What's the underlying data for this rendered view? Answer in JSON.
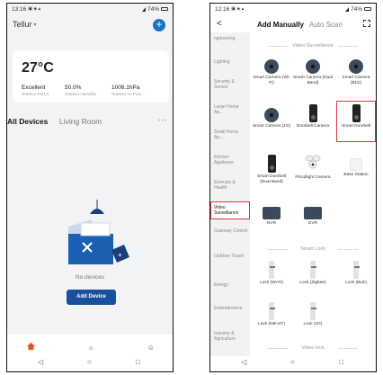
{
  "colors": {
    "accent": "#1a73c8",
    "button": "#1a4f9c",
    "highlight": "#d9363e",
    "home_active": "#e2541a"
  },
  "left": {
    "status": {
      "time": "13:16",
      "battery": "74%"
    },
    "home_name": "Tellur",
    "weather": {
      "temperature": "27°C",
      "stats": [
        {
          "value": "Excellent",
          "label": "Outdoor PM2.5"
        },
        {
          "value": "50.0%",
          "label": "Outdoor Humidity"
        },
        {
          "value": "1006.1hPa",
          "label": "Outdoor Air Pres..."
        }
      ]
    },
    "tabs": [
      "All Devices",
      "Living Room"
    ],
    "more": "···",
    "empty_text": "No devices",
    "add_device_label": "Add Device",
    "nav": [
      {
        "label": "Home",
        "icon": "home-icon"
      },
      {
        "label": "Smart",
        "icon": "sun-icon"
      },
      {
        "label": "Me",
        "icon": "user-icon"
      }
    ]
  },
  "right": {
    "status": {
      "time": "12:16",
      "battery": "74%"
    },
    "header": {
      "back": "<",
      "tab_manual": "Add Manually",
      "tab_auto": "Auto Scan"
    },
    "sidebar": [
      "ngineering",
      "Lighting",
      "Security & Sensor",
      "Large Home Ap...",
      "Small Home Ap...",
      "Kitchen Appliance",
      "Exercise & Health",
      "Video Surveillance",
      "Gateway Control",
      "Outdoor Travel",
      "Energy",
      "Entertainment",
      "Industry & Agriculture"
    ],
    "sections": {
      "video": "Video Surveillance",
      "lock": "Smart Lock",
      "video_lock": "Video lock"
    },
    "video_devices": [
      "Smart Camera (Wi-Fi)",
      "Smart Camera (Dual Band)",
      "Smart Camera (BLE)",
      "Smart Camera (4G)",
      "Doorbell Camera",
      "Smart Doorbell",
      "Smart Doorbell (Dual Band)",
      "Floodlight Camera",
      "Base Station",
      "NVR",
      "DVR"
    ],
    "lock_devices": [
      "Lock (Wi-Fi)",
      "Lock (Zigbee)",
      "Lock (BLE)",
      "Lock (NB-IoT)",
      "Lock (4G)"
    ]
  }
}
